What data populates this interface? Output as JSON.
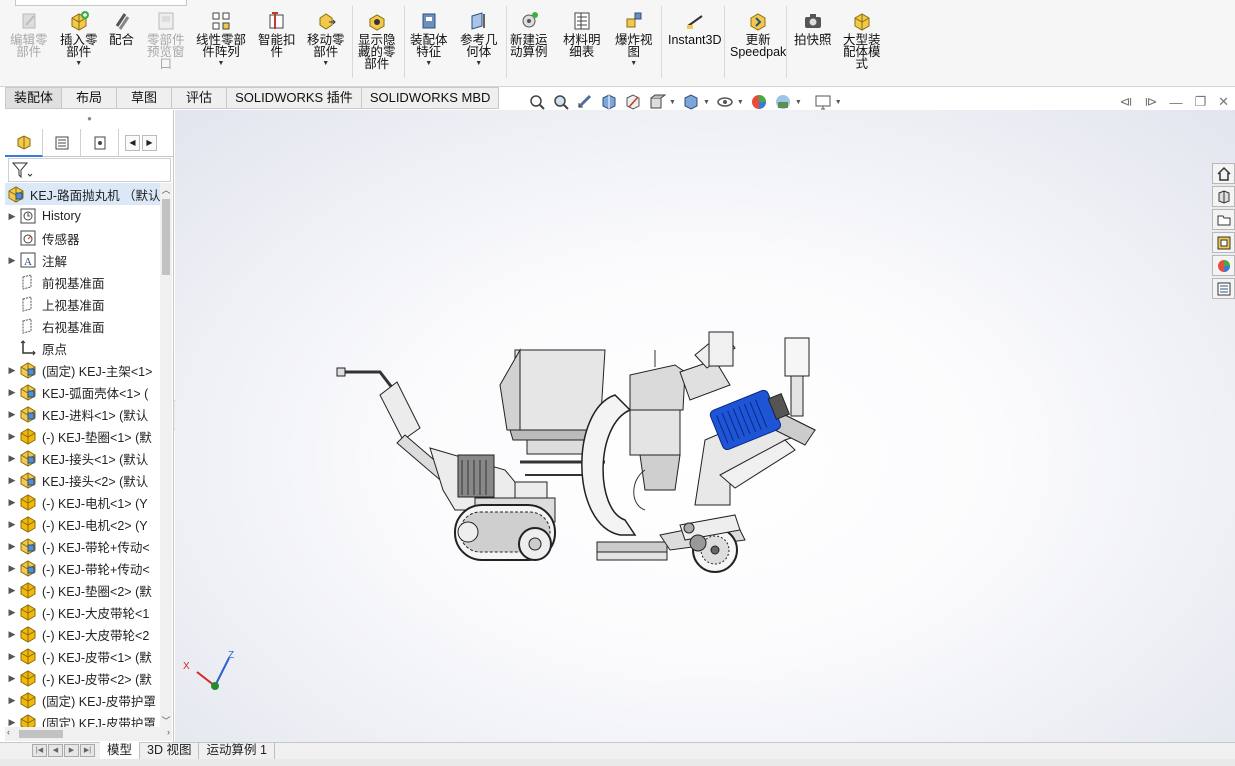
{
  "ribbon": {
    "buttons": [
      {
        "label": "编辑零\n部件",
        "icon": "edit-component-icon",
        "disabled": true,
        "caret": false
      },
      {
        "label": "插入零\n部件",
        "icon": "insert-components-icon",
        "disabled": false,
        "caret": true
      },
      {
        "label": "配合",
        "icon": "mate-icon",
        "disabled": false,
        "caret": false
      },
      {
        "label": "零部件\n预览窗\n口",
        "icon": "component-preview-icon",
        "disabled": true,
        "caret": false
      },
      {
        "label": "线性零部\n件阵列",
        "icon": "linear-pattern-icon",
        "disabled": false,
        "caret": true
      },
      {
        "label": "智能扣\n件",
        "icon": "smart-fasteners-icon",
        "disabled": false,
        "caret": false
      },
      {
        "label": "移动零\n部件",
        "icon": "move-component-icon",
        "disabled": false,
        "caret": true
      },
      {
        "label": "显示隐\n藏的零\n部件",
        "icon": "show-hidden-icon",
        "disabled": false,
        "caret": false
      },
      {
        "label": "装配体\n特征",
        "icon": "assembly-features-icon",
        "disabled": false,
        "caret": true
      },
      {
        "label": "参考几\n何体",
        "icon": "reference-geometry-icon",
        "disabled": false,
        "caret": true
      },
      {
        "label": "新建运\n动算例",
        "icon": "new-motion-study-icon",
        "disabled": false,
        "caret": false
      },
      {
        "label": "材料明\n细表",
        "icon": "bill-of-materials-icon",
        "disabled": false,
        "caret": false
      },
      {
        "label": "爆炸视\n图",
        "icon": "exploded-view-icon",
        "disabled": false,
        "caret": true
      },
      {
        "label": "Instant3D",
        "icon": "instant3d-icon",
        "disabled": false,
        "caret": false
      },
      {
        "label": "更新\nSpeedpak",
        "icon": "speedpak-icon",
        "disabled": false,
        "caret": false
      },
      {
        "label": "拍快照",
        "icon": "snapshot-icon",
        "disabled": false,
        "caret": false
      },
      {
        "label": "大型装\n配体模\n式",
        "icon": "large-assembly-icon",
        "disabled": false,
        "caret": false
      }
    ]
  },
  "command_tabs": [
    "装配体",
    "布局",
    "草图",
    "评估",
    "SOLIDWORKS 插件",
    "SOLIDWORKS MBD"
  ],
  "active_command_tab": "装配体",
  "feature_tree": {
    "root": "KEJ-路面抛丸机 （默认<",
    "items": [
      {
        "label": "History",
        "icon": "history-icon",
        "expandable": true
      },
      {
        "label": "传感器",
        "icon": "sensor-icon",
        "expandable": false
      },
      {
        "label": "注解",
        "icon": "annotation-icon",
        "expandable": true
      },
      {
        "label": "前视基准面",
        "icon": "plane-icon",
        "expandable": false
      },
      {
        "label": "上视基准面",
        "icon": "plane-icon",
        "expandable": false
      },
      {
        "label": "右视基准面",
        "icon": "plane-icon",
        "expandable": false
      },
      {
        "label": "原点",
        "icon": "origin-icon",
        "expandable": false
      },
      {
        "label": "(固定) KEJ-主架<1>",
        "icon": "subassembly-icon",
        "expandable": true
      },
      {
        "label": "KEJ-弧面壳体<1> (",
        "icon": "subassembly-icon",
        "expandable": true
      },
      {
        "label": "KEJ-进料<1> (默认",
        "icon": "subassembly-icon",
        "expandable": true
      },
      {
        "label": "(-) KEJ-垫圈<1> (默",
        "icon": "part-icon",
        "expandable": true
      },
      {
        "label": "KEJ-接头<1> (默认",
        "icon": "subassembly-icon",
        "expandable": true
      },
      {
        "label": "KEJ-接头<2> (默认",
        "icon": "subassembly-icon",
        "expandable": true
      },
      {
        "label": "(-) KEJ-电机<1> (Y",
        "icon": "part-icon",
        "expandable": true
      },
      {
        "label": "(-) KEJ-电机<2> (Y",
        "icon": "part-icon",
        "expandable": true
      },
      {
        "label": "(-) KEJ-带轮+传动<",
        "icon": "subassembly-icon",
        "expandable": true
      },
      {
        "label": "(-) KEJ-带轮+传动<",
        "icon": "subassembly-icon",
        "expandable": true
      },
      {
        "label": "(-) KEJ-垫圈<2> (默",
        "icon": "part-icon",
        "expandable": true
      },
      {
        "label": "(-) KEJ-大皮带轮<1",
        "icon": "part-icon",
        "expandable": true
      },
      {
        "label": "(-) KEJ-大皮带轮<2",
        "icon": "part-icon",
        "expandable": true
      },
      {
        "label": "(-) KEJ-皮带<1> (默",
        "icon": "part-icon",
        "expandable": true
      },
      {
        "label": "(-) KEJ-皮带<2> (默",
        "icon": "part-icon",
        "expandable": true
      },
      {
        "label": "(固定) KEJ-皮带护罩",
        "icon": "part-icon",
        "expandable": true
      },
      {
        "label": "(固定) KEJ-皮带护罩",
        "icon": "part-icon",
        "expandable": true
      }
    ]
  },
  "triad": {
    "x": "X",
    "z": "Z"
  },
  "bottom_tabs": [
    "模型",
    "3D 视图",
    "运动算例 1"
  ],
  "active_bottom_tab": "模型",
  "colors": {
    "accent_blue": "#3a7bd5",
    "part_yellow": "#f2b90b",
    "subasm_blue": "#4f8fd6",
    "motor_blue": "#1e54d6"
  }
}
